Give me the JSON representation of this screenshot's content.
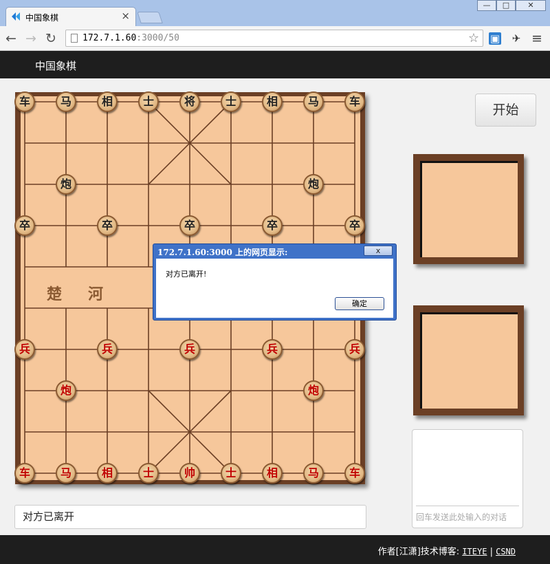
{
  "browser": {
    "tab_title": "中国象棋",
    "tab_close": "×",
    "url_host": "172.7.1.60",
    "url_path": ":3000/50",
    "back": "←",
    "forward": "→",
    "reload": "↻",
    "star": "☆",
    "menu": "≡",
    "win_min": "—",
    "win_max": "□",
    "win_close": "✕"
  },
  "app": {
    "brand": "中国象棋",
    "start_button": "开始",
    "status_text": "对方已离开",
    "chat_placeholder": "回车发送此处输入的对话"
  },
  "board": {
    "river_left": [
      "楚",
      "河"
    ],
    "black_back_row": [
      "车",
      "马",
      "相",
      "士",
      "将",
      "士",
      "相",
      "马",
      "车"
    ],
    "black_cannon": "炮",
    "black_soldier": "卒",
    "red_back_row": [
      "车",
      "马",
      "相",
      "士",
      "帅",
      "士",
      "相",
      "马",
      "车"
    ],
    "red_cannon": "炮",
    "red_soldier": "兵"
  },
  "footer": {
    "prefix": "作者[江潇]技术博客:",
    "link1": "ITEYE",
    "sep": "|",
    "link2": "CSND"
  },
  "dialog": {
    "title": "172.7.1.60:3000 上的网页显示:",
    "close": "x",
    "message": "对方已离开!",
    "ok": "确定"
  },
  "colors": {
    "board_frame": "#6b3f25",
    "board_fill": "#f6c79b",
    "red_piece_text": "#c00000",
    "black_piece_text": "#222222",
    "dialog_title_bar": "#3f72c8"
  }
}
